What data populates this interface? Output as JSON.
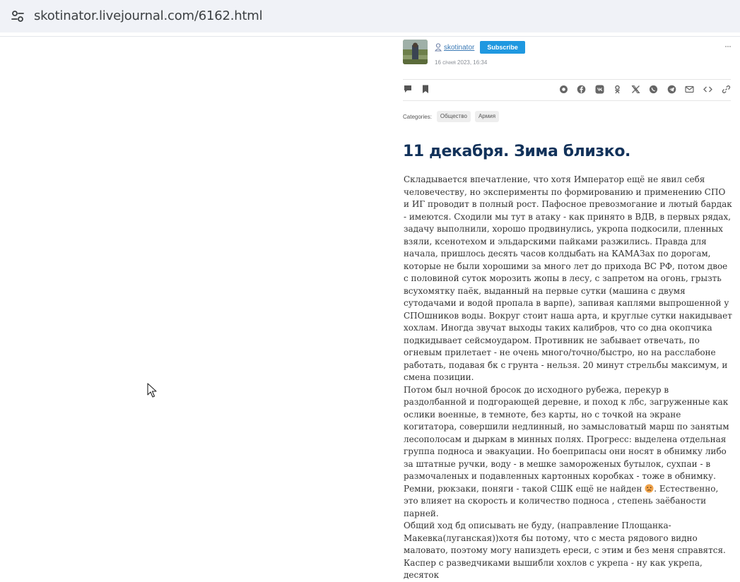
{
  "browser": {
    "url": "skotinator.livejournal.com/6162.html"
  },
  "post": {
    "author": "skotinator",
    "subscribe_label": "Subscribe",
    "date": "16 січня 2023, 16:34",
    "more": "···",
    "categories_label": "Categories:",
    "categories": [
      "Общество",
      "Армия"
    ],
    "title": "11 декабря. Зима близко.",
    "paragraphs": [
      "Складывается впечатление, что хотя Император ещё не явил себя человечеству, но эксперименты по формированию и применению СПО и ИГ проводит в полный рост. Пафосное превозмогание и лютый бардак - имеются. Сходили мы тут в атаку - как принято в ВДВ, в первых рядах, задачу выполнили, хорошо продвинулись, укропа подкосили, пленных взяли, ксенотехом и эльдарскими пайками разжились. Правда для начала, пришлось десять часов колдыбать на КАМАЗах по дорогам, которые не были хорошими за много лет до прихода ВС РФ, потом двое с половиной суток морозить жопы в лесу, с запретом на огонь, грызть всухомятку паёк, выданный на первые сутки (машина с двумя сутодачами и водой пропала в варпе), запивая каплями выпрошенной у СПОшников воды. Вокруг стоит наша арта, и круглые сутки накидывает хохлам. Иногда звучат выходы таких калибров, что со дна окопчика подкидывает сейсмоударом. Противник не забывает отвечать, по огневым прилетает - не очень много/точно/быстро, но на расслабоне работать, подавая бк с грунта - нельзя. 20 минут стрельбы максимум, и смена позиции.",
      "Потом был ночной бросок до исходного рубежа, перекур в раздолбанной и подгорающей деревне, и поход к лбс, загруженные как ослики военные, в темноте, без карты, но с точкой на экране когитатора, совершили недлинный, но замысловатый марш по занятым лесополосам и дыркам в минных полях. Прогресс: выделена отдельная группа подноса и эвакуации. Но боеприпасы они носят в обнимку либо за штатные ручки, воду - в мешке замороженых бутылок, сухпаи - в размочаленых и подавленных картонных коробках - тоже в обнимку. Ремни, рюкзаки, поняги - такой СШК ещё не найден",
      ". Естественно, это влияет на скорость и количество подноса , степень заёбаности парней.",
      "Общий ход бд описывать не буду, (направление Площанка-Макевка(луганская))хотя бы потому, что с места рядового видно маловато, поэтому могу напиздеть ереси, с этим и без меня справятся.",
      "Каспер с разведчиками вышибли хохлов с укрепа - ну как укрепа, десяток"
    ],
    "emoji_icon": "disappointed-face"
  },
  "colors": {
    "title": "#12325a",
    "link": "#3a79b5",
    "subscribe": "#1f98e0",
    "urlbar": "#f0f2f7"
  }
}
